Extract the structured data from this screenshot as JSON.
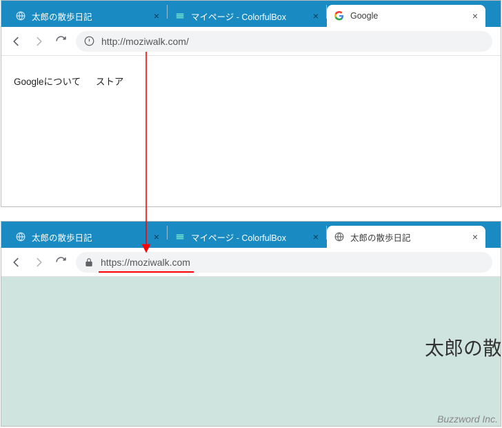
{
  "topBrowser": {
    "tabs": [
      {
        "favicon": "globe",
        "title": "太郎の散歩日記"
      },
      {
        "favicon": "cbox",
        "title": "マイページ - ColorfulBox"
      },
      {
        "favicon": "google",
        "title": "Google",
        "active": true
      }
    ],
    "url": "http://moziwalk.com/",
    "links": {
      "about": "Googleについて",
      "store": "ストア"
    }
  },
  "bottomBrowser": {
    "tabs": [
      {
        "favicon": "globe",
        "title": "太郎の散歩日記"
      },
      {
        "favicon": "cbox",
        "title": "マイページ - ColorfulBox"
      },
      {
        "favicon": "globe-dark",
        "title": "太郎の散歩日記",
        "active": true
      }
    ],
    "url": "https://moziwalk.com",
    "siteHeading": "太郎の散"
  },
  "watermark": "Buzzword Inc."
}
